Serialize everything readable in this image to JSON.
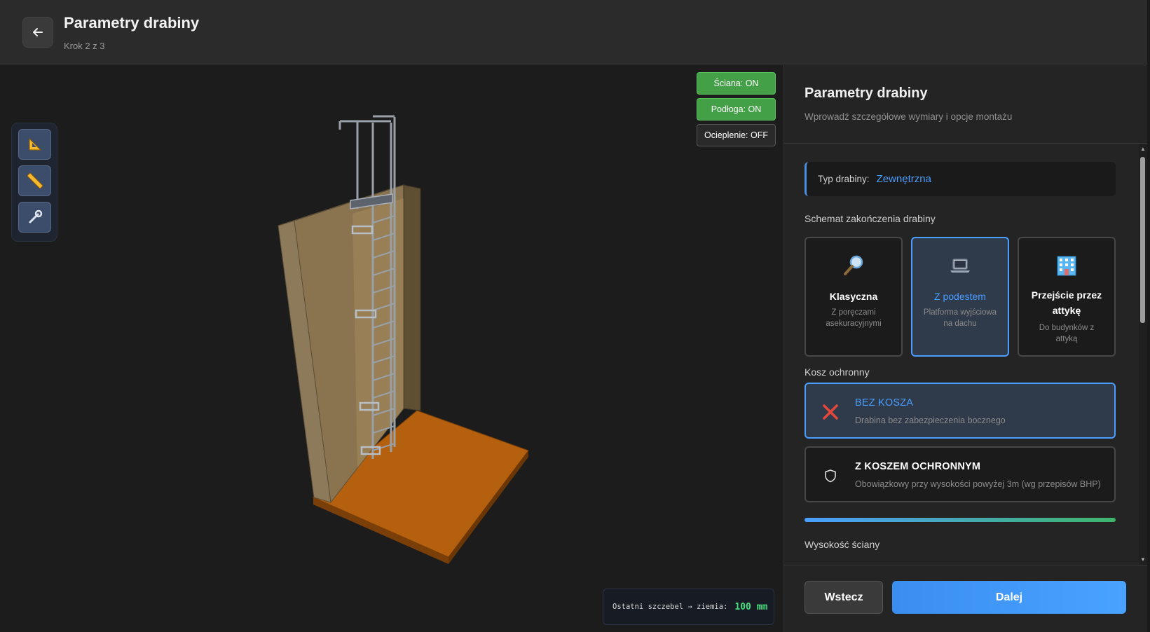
{
  "header": {
    "title": "Parametry drabiny",
    "step": "Krok 2 z 3"
  },
  "viewport": {
    "toggles": [
      {
        "label": "Ściana: ON",
        "state": "on"
      },
      {
        "label": "Podłoga: ON",
        "state": "on"
      },
      {
        "label": "Ocieplenie: OFF",
        "state": "off"
      }
    ],
    "tools": [
      "triangle-ruler-icon",
      "ruler-icon",
      "wrench-icon"
    ],
    "readout": {
      "label": "Ostatni szczebel → ziemia:",
      "value": "100 mm"
    }
  },
  "panel": {
    "title": "Parametry drabiny",
    "subtitle": "Wprowadź szczegółowe wymiary i opcje montażu",
    "type_label": "Typ drabiny:",
    "type_value": "Zewnętrzna",
    "scheme_label": "Schemat zakończenia drabiny",
    "schemes": [
      {
        "name": "Klasyczna",
        "desc_line1": "Z poręczami",
        "desc_line2": "asekuracyjnymi",
        "icon": "magnifier-icon",
        "selected": false
      },
      {
        "name": "Z podestem",
        "desc_line1": "Platforma wyjściowa",
        "desc_line2": "na dachu",
        "icon": "laptop-icon",
        "selected": true
      },
      {
        "name_line1": "Przejście przez",
        "name_line2": "attykę",
        "desc_line1": "Do budynków z",
        "desc_line2": "attyką",
        "icon": "building-icon",
        "selected": false
      }
    ],
    "cage_label": "Kosz ochronny",
    "cages": [
      {
        "name": "BEZ KOSZA",
        "desc": "Drabina bez zabezpieczenia bocznego",
        "icon": "cross-icon",
        "selected": true
      },
      {
        "name": "Z KOSZEM OCHRONNYM",
        "desc": "Obowiązkowy przy wysokości powyżej 3m (wg przepisów BHP)",
        "icon": "shield-icon",
        "selected": false
      }
    ],
    "wall_height_label": "Wysokość ściany",
    "buttons": {
      "back": "Wstecz",
      "next": "Dalej"
    }
  },
  "colors": {
    "accent": "#4a9eff",
    "toggle_on": "#43a047",
    "readout_value": "#4ade80",
    "floor": "#b4600f",
    "wall": "#8a7450"
  }
}
